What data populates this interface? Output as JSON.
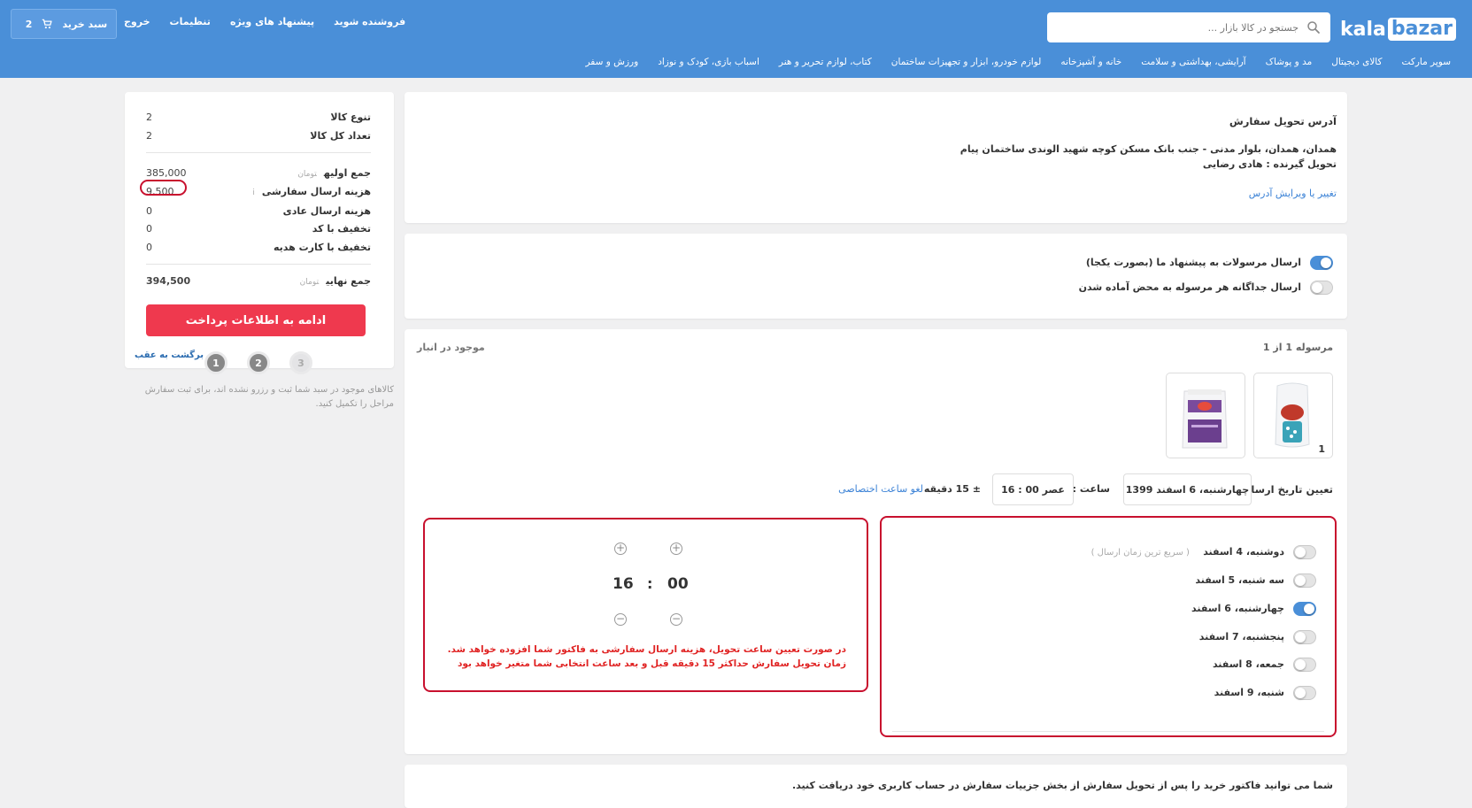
{
  "header": {
    "logo": {
      "kala": "kala",
      "bazar": "bazar"
    },
    "search_placeholder": "جستجو در کالا بازار ...",
    "top_links": [
      "فروشنده شوید",
      "پیشنهاد های ویژه",
      "تنظیمات",
      "خروج"
    ],
    "cart": {
      "label": "سبد خرید",
      "count": "2"
    },
    "categories": [
      "سوپر مارکت",
      "کالای دیجیتال",
      "مد و پوشاک",
      "آرایشی، بهداشتی و سلامت",
      "خانه و آشپزخانه",
      "لوازم خودرو، ابزار و تجهیزات ساختمان",
      "کتاب، لوازم تحریر و هنر",
      "اسباب بازی، کودک و نوزاد",
      "ورزش و سفر"
    ]
  },
  "address": {
    "title": "آدرس تحویل سفارش",
    "line": "همدان، همدان، بلوار مدنی - جنب بانک مسکن کوچه شهید الوندی ساختمان پیام",
    "recipient": "تحویل گیرنده : هادی رضایی",
    "edit_link": "تغییر یا ویرایش آدرس"
  },
  "shipping_options": {
    "combined": "ارسال مرسولات به پیشنهاد ما (بصورت یکجا)",
    "separate": "ارسال جداگانه هر مرسوله به محض آماده شدن"
  },
  "parcel": {
    "title": "مرسوله 1 از 1",
    "stock": "موجود در انبار",
    "product_qty_badge": "1",
    "date_label": "تعیین تاریخ ارسال :",
    "date_value": "چهارشنبه، 6 اسفند 1399",
    "time_label": "ساعت :",
    "time_value": "16 : 00 عصر",
    "tolerance": "± 15 دقیقه",
    "cancel_link": "لغو ساعت اختصاصی",
    "days": [
      {
        "label": "دوشنبه، 4 اسفند",
        "note": "( سریع ترین زمان ارسال )",
        "on": false
      },
      {
        "label": "سه شنبه، 5 اسفند",
        "note": "",
        "on": false
      },
      {
        "label": "چهارشنبه، 6 اسفند",
        "note": "",
        "on": true
      },
      {
        "label": "پنجشنبه، 7 اسفند",
        "note": "",
        "on": false
      },
      {
        "label": "جمعه، 8 اسفند",
        "note": "",
        "on": false
      },
      {
        "label": "شنبه، 9 اسفند",
        "note": "",
        "on": false
      }
    ],
    "picker": {
      "hour": "16",
      "minute": "00",
      "separator": ":",
      "warning_1": "در صورت تعیین ساعت تحویل، هزینه ارسال سفارشی به فاکتور شما افزوده خواهد شد.",
      "warning_2": "زمان تحویل سفارش حداکثر 15 دقیقه قبل و بعد ساعت انتخابی شما متغیر خواهد بود"
    }
  },
  "invoice_note": "شما می توانید فاکتور خرید را پس از تحویل سفارش از بخش جزییات سفارش در حساب کاربری خود دریافت کنید.",
  "summary": {
    "variety_label": "تنوع کالا",
    "variety_value": "2",
    "count_label": "تعداد کل کالا",
    "count_value": "2",
    "subtotal_label": "جمع اولیه",
    "subtotal_value": "385,000",
    "unit": "تومان",
    "custom_ship_label": "هزینه ارسال سفارشی",
    "custom_ship_info": "i",
    "custom_ship_value": "9,500",
    "normal_ship_label": "هزینه ارسال عادی",
    "normal_ship_value": "0",
    "code_discount_label": "تخفیف با کد",
    "code_discount_value": "0",
    "gift_discount_label": "تخفیف با کارت هدیه",
    "gift_discount_value": "0",
    "total_label": "جمع نهایی",
    "total_value": "394,500",
    "pay_button": "ادامه به اطلاعات پرداخت",
    "back_link": "برگشت به عقب",
    "steps": [
      "1",
      "2",
      "3"
    ],
    "note": "کالاهای موجود در سبد شما ثبت و رزرو نشده اند، برای ثبت سفارش مراحل را تکمیل کنید."
  },
  "colors": {
    "brand": "#4a8fd8",
    "danger": "#ef394e",
    "highlight": "#c8102e"
  }
}
